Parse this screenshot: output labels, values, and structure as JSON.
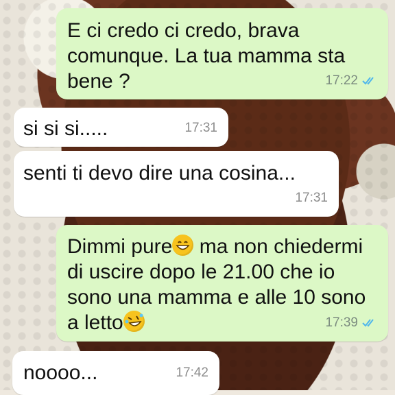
{
  "messages": [
    {
      "direction": "out",
      "text": "E ci credo ci credo, brava\ncomunque. La tua mamma sta\nbene ?",
      "time": "17:22",
      "status": "read"
    },
    {
      "direction": "in",
      "text": "si si si.....",
      "time": "17:31"
    },
    {
      "direction": "in",
      "text": "senti ti devo dire una cosina...",
      "time": "17:31"
    },
    {
      "direction": "out",
      "text_parts": [
        "Dimmi pure",
        "ma non chiedermi\ndi uscire dopo le 21.00 che io\nsono una mamma e alle 10 sono\na letto"
      ],
      "time": "17:39",
      "status": "read",
      "emojis": [
        "grinning-face-icon",
        "rolling-laughing-face-icon"
      ]
    },
    {
      "direction": "in",
      "text": "noooo...",
      "time": "17:42"
    }
  ],
  "colors": {
    "outgoing_bubble": "#dcf8c6",
    "incoming_bubble": "#ffffff",
    "read_ticks": "#4fb6ec"
  }
}
